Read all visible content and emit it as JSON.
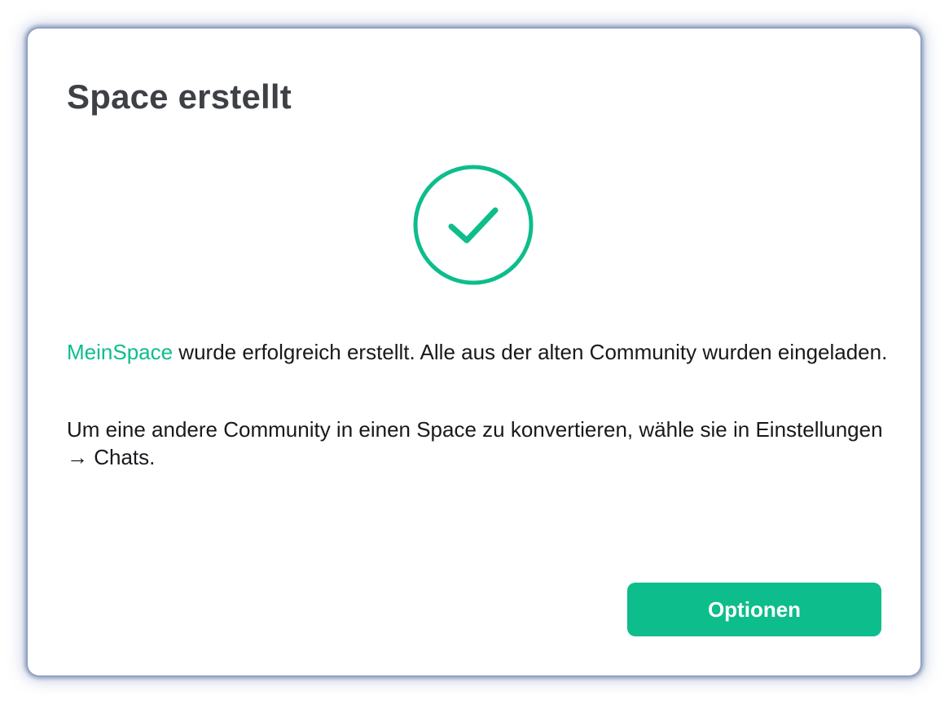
{
  "dialog": {
    "title": "Space erstellt",
    "icon": "checkmark-circle-icon",
    "message": {
      "space_name": "MeinSpace",
      "rest": " wurde erfolgreich erstellt. Alle aus der alten Community wurden eingeladen."
    },
    "hint": "Um eine andere Community in einen Space zu konvertieren, wähle sie in Einstellungen → Chats.",
    "button_label": "Optionen"
  },
  "colors": {
    "accent": "#0dbd8b",
    "title_text": "#3d4146",
    "body_text": "#17191c",
    "background": "#ffffff"
  }
}
